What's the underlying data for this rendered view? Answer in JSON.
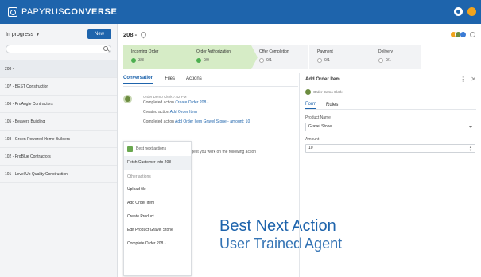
{
  "brand": {
    "light": "PAPYRUS",
    "bold": "CONVERSE"
  },
  "left": {
    "filter": "In progress",
    "new_label": "New",
    "search_placeholder": "",
    "items": [
      {
        "label": "208 -"
      },
      {
        "label": "107 - BEST Construction"
      },
      {
        "label": "106 - ProAngle Contractors"
      },
      {
        "label": "105 - Beavers Building"
      },
      {
        "label": "103 - Green Powered Home Builders"
      },
      {
        "label": "102 - ProBlue Contractors"
      },
      {
        "label": "101 - Level Up Quality Construction"
      }
    ]
  },
  "main": {
    "title": "208 -",
    "stages": [
      {
        "label": "Incoming Order",
        "count": "3/3",
        "state": "done"
      },
      {
        "label": "Order Authorization",
        "count": "0/0",
        "state": "done"
      },
      {
        "label": "Offer Completion",
        "count": "0/1",
        "state": "todo"
      },
      {
        "label": "Payment",
        "count": "0/1",
        "state": "todo"
      },
      {
        "label": "Delivery",
        "count": "0/1",
        "state": "todo"
      }
    ]
  },
  "conversation": {
    "tabs": [
      "Conversation",
      "Files",
      "Actions"
    ],
    "msg1": {
      "meta": "Order Demo Clerk   7:42 PM",
      "line1_pre": "Completed action ",
      "line1_link": "Create Order 208 -",
      "line2_pre": "Created action ",
      "line2_link": "Add Order Item",
      "line3_pre": "Completed action ",
      "line3_link": "Add Order Item Gravel Stone - amount: 10"
    },
    "msg2": {
      "meta": "Dashie   7:43 PM",
      "text": "Hi Order Demo Clerk! I suggest you work on the following action",
      "link": "Fetch Customer Info"
    }
  },
  "bna": {
    "title": "Best next actions",
    "top": "Fetch Customer Info 208 -",
    "other_label": "Other actions",
    "items": [
      "Upload file",
      "Add Order Item",
      "Create Product",
      "Edit Product Gravel Stone",
      "Complete Order 208 -"
    ]
  },
  "overlay": {
    "line1": "Best Next Action",
    "line2": "User Trained Agent"
  },
  "right": {
    "title": "Add Order Item",
    "user": "Order Demo Clerk",
    "tabs": [
      "Form",
      "Rules"
    ],
    "product_label": "Product Name",
    "product_value": "Gravel Stone",
    "amount_label": "Amount",
    "amount_value": "10"
  },
  "colors": {
    "brand": "#1e64ac",
    "done": "#d6ecc6",
    "todo": "#f2f3f5"
  }
}
